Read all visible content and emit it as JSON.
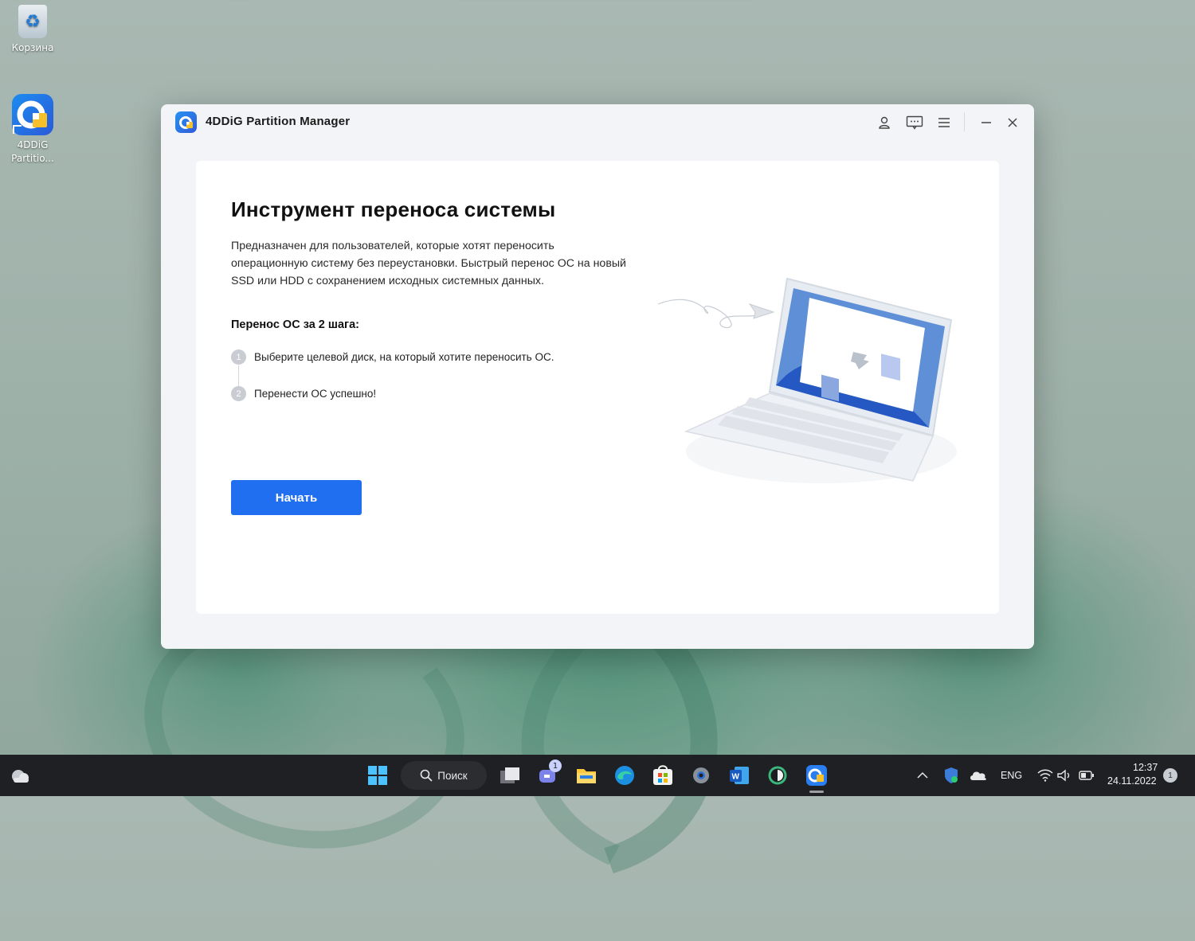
{
  "desktop": {
    "icons": [
      {
        "label": "Корзина"
      },
      {
        "label": "4DDiG\nPartitio..."
      }
    ]
  },
  "window": {
    "title": "4DDiG Partition Manager",
    "controls": [
      "user-icon",
      "feedback-icon",
      "menu-icon",
      "minimize-icon",
      "close-icon"
    ]
  },
  "main": {
    "heading": "Инструмент переноса системы",
    "description": "Предназначен для пользователей, которые хотят переносить операционную систему без переустановки. Быстрый перенос ОС на новый SSD или HDD с сохранением исходных системных данных.",
    "steps_title": "Перенос ОС за 2 шага:",
    "steps": [
      {
        "num": "1",
        "text": "Выберите целевой диск, на который хотите переносить ОС."
      },
      {
        "num": "2",
        "text": "Перенести ОС успешно!"
      }
    ],
    "start_label": "Начать"
  },
  "taskbar": {
    "search_label": "Поиск",
    "chat_badge": "1",
    "language": "ENG",
    "time": "12:37",
    "date": "24.11.2022",
    "notification_count": "1"
  },
  "colors": {
    "accent": "#1f6ff0",
    "taskbar": "#1f2023"
  }
}
